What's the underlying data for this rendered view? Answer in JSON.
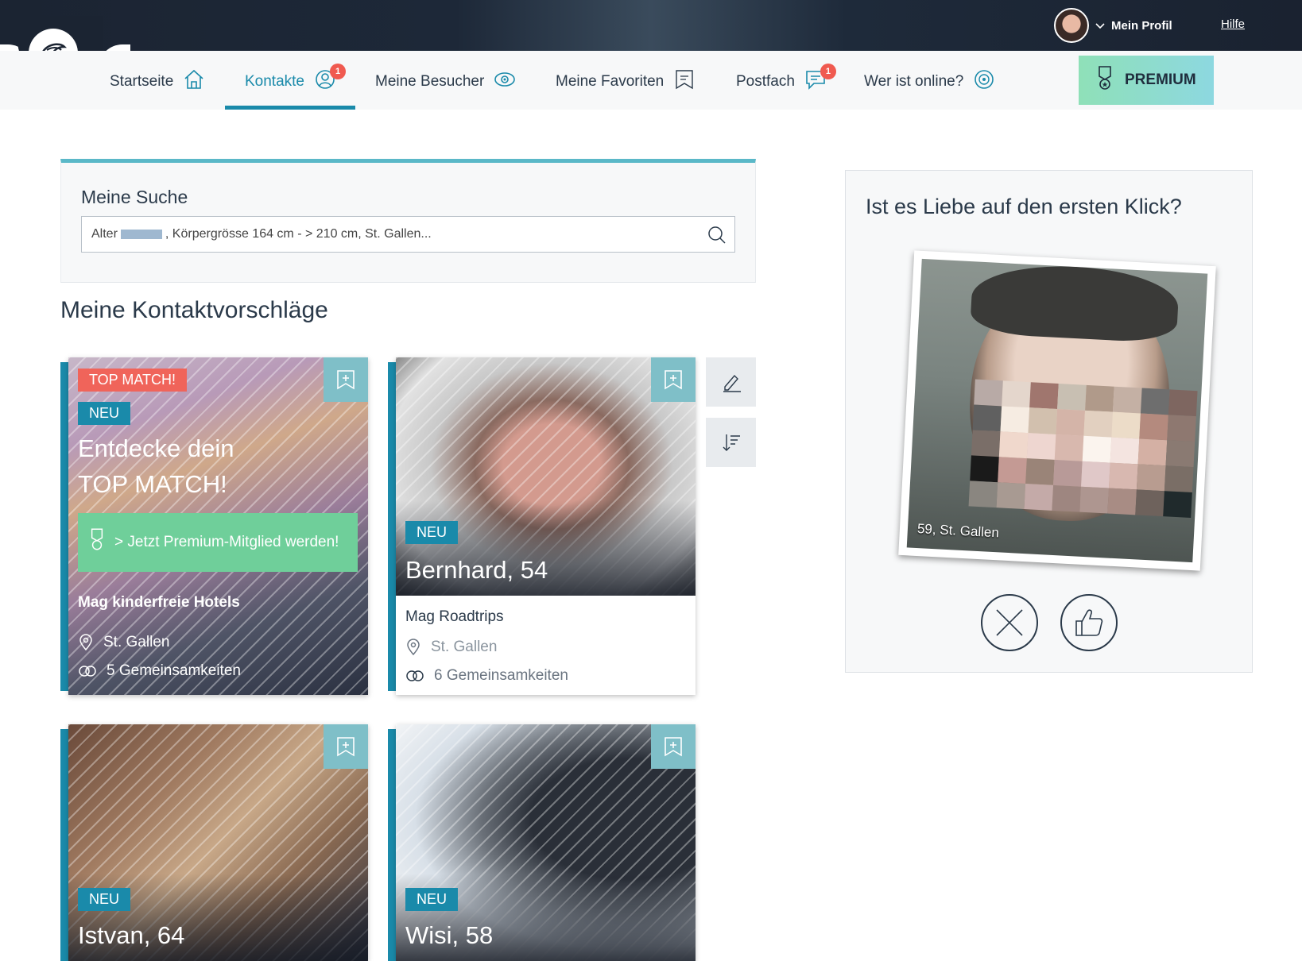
{
  "header": {
    "profile_label": "Mein Profil",
    "help_label": "Hilfe"
  },
  "nav": {
    "items": [
      {
        "label": "Startseite"
      },
      {
        "label": "Kontakte",
        "badge": "1"
      },
      {
        "label": "Meine Besucher"
      },
      {
        "label": "Meine Favoriten"
      },
      {
        "label": "Postfach",
        "badge": "1"
      },
      {
        "label": "Wer ist online?"
      }
    ],
    "premium_label": "PREMIUM"
  },
  "search": {
    "title": "Meine Suche",
    "value_prefix": "Alter",
    "value_rest": ", Körpergrösse 164 cm - > 210 cm, St. Gallen..."
  },
  "suggestions": {
    "title": "Meine Kontaktvorschläge",
    "cards": [
      {
        "top_match_tag": "TOP MATCH!",
        "tag": "NEU",
        "headline_1": "Entdecke dein",
        "headline_2": "TOP MATCH!",
        "cta": "> Jetzt Premium-Mitglied werden!",
        "interest": "Mag kinderfreie Hotels",
        "location": "St. Gallen",
        "common": "5 Gemeinsamkeiten"
      },
      {
        "tag": "NEU",
        "name": "Bernhard, 54",
        "interest": "Mag Roadtrips",
        "location": "St. Gallen",
        "common": "6 Gemeinsamkeiten"
      },
      {
        "tag": "NEU",
        "name": "Istvan, 64"
      },
      {
        "tag": "NEU",
        "name": "Wisi, 58"
      }
    ]
  },
  "quickmatch": {
    "title": "Ist es Liebe auf den ersten Klick?",
    "photo_caption": "59, St. Gallen"
  },
  "colors": {
    "accent": "#1a8aaa",
    "badge": "#f05a50",
    "premium_green": "#8fe0b8",
    "cta_green": "#6fcf9a",
    "top_match": "#f0645a"
  }
}
